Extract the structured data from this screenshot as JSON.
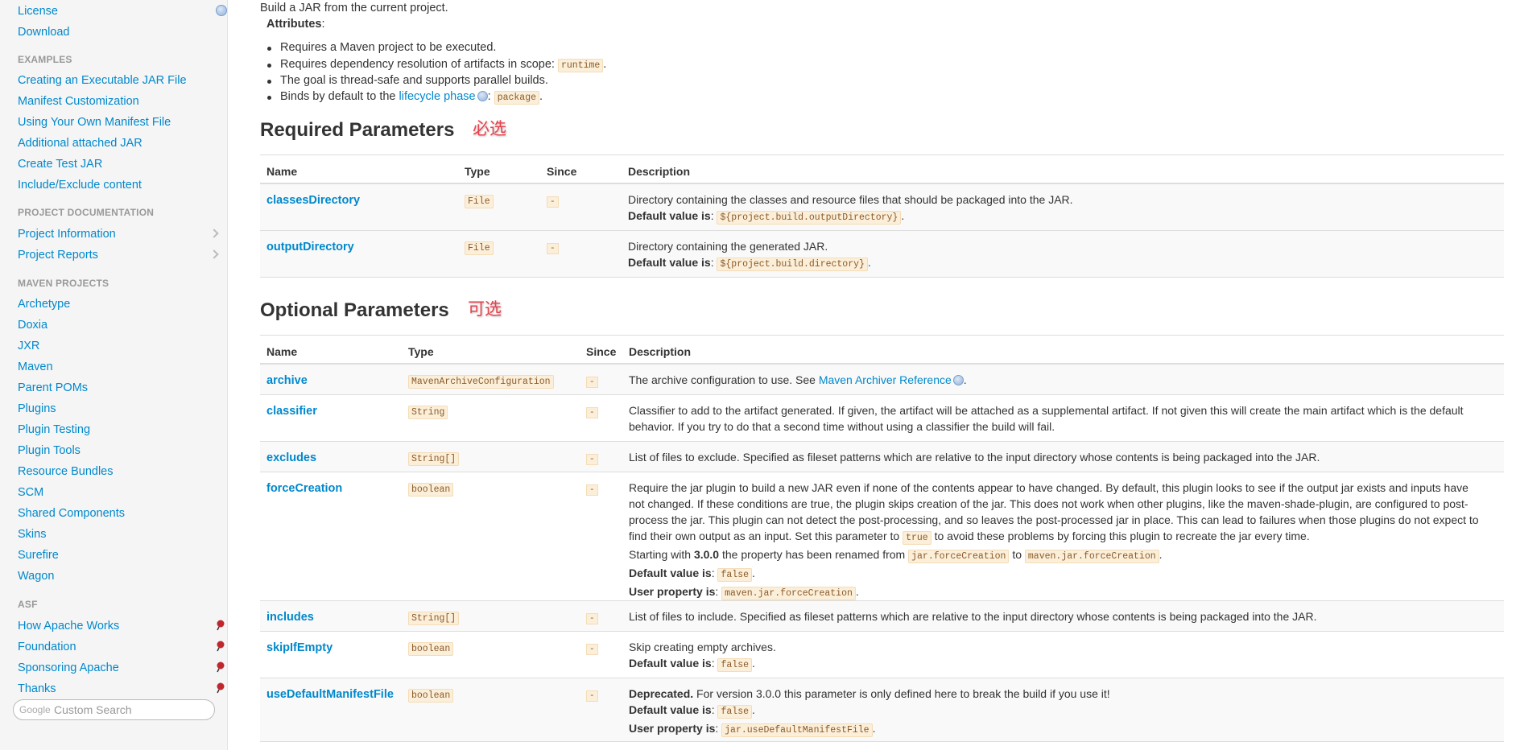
{
  "sidebar": {
    "top_items": [
      "License",
      "Download"
    ],
    "examples_header": "EXAMPLES",
    "examples": [
      "Creating an Executable JAR File",
      "Manifest Customization",
      "Using Your Own Manifest File",
      "Additional attached JAR",
      "Create Test JAR",
      "Include/Exclude content"
    ],
    "project_doc_header": "PROJECT DOCUMENTATION",
    "project_doc": [
      "Project Information",
      "Project Reports"
    ],
    "maven_header": "MAVEN PROJECTS",
    "maven": [
      "Archetype",
      "Doxia",
      "JXR",
      "Maven",
      "Parent POMs",
      "Plugins",
      "Plugin Testing",
      "Plugin Tools",
      "Resource Bundles",
      "SCM",
      "Shared Components",
      "Skins",
      "Surefire",
      "Wagon"
    ],
    "asf_header": "ASF",
    "asf": [
      "How Apache Works",
      "Foundation",
      "Sponsoring Apache",
      "Thanks"
    ],
    "search_logo": "Google",
    "search_placeholder": "Custom Search"
  },
  "intro": {
    "line": "Build a JAR from the current project.",
    "attributes_label": "Attributes",
    "colon": ":",
    "b1": "Requires a Maven project to be executed.",
    "b2_text": "Requires dependency resolution of artifacts in scope: ",
    "b2_code": "runtime",
    "b2_end": ".",
    "b3": "The goal is thread-safe and supports parallel builds.",
    "b4_text": "Binds by default to the ",
    "b4_link": "lifecycle phase",
    "b4_colon": ": ",
    "b4_code": "package",
    "b4_end": "."
  },
  "required": {
    "title": "Required Parameters",
    "annotation": "必选",
    "headers": [
      "Name",
      "Type",
      "Since",
      "Description"
    ],
    "rows": [
      {
        "name": "classesDirectory",
        "type": "File",
        "since": "-",
        "desc": "Directory containing the classes and resource files that should be packaged into the JAR.",
        "default_label": "Default value is",
        "default": "${project.build.outputDirectory}"
      },
      {
        "name": "outputDirectory",
        "type": "File",
        "since": "-",
        "desc": "Directory containing the generated JAR.",
        "default_label": "Default value is",
        "default": "${project.build.directory}"
      }
    ]
  },
  "optional": {
    "title": "Optional Parameters",
    "annotation": "可选",
    "headers": [
      "Name",
      "Type",
      "Since",
      "Description"
    ],
    "rows": [
      {
        "name": "archive",
        "type": "MavenArchiveConfiguration",
        "since": "-",
        "desc": "The archive configuration to use. See ",
        "link": "Maven Archiver Reference"
      },
      {
        "name": "classifier",
        "type": "String",
        "since": "-",
        "desc1": "Classifier to add to the artifact generated. If given, the artifact will be attached as a supplemental artifact. If not given this will create the main artifact which is the default",
        "desc2": "behavior. If you try to do that a second time without using a classifier the build will fail."
      },
      {
        "name": "excludes",
        "type": "String[]",
        "since": "-",
        "desc": "List of files to exclude. Specified as fileset patterns which are relative to the input directory whose contents is being packaged into the JAR."
      },
      {
        "name": "forceCreation",
        "type": "boolean",
        "since": "-",
        "l1": "Require the jar plugin to build a new JAR even if none of the contents appear to have changed. By default, this plugin looks to see if the output jar exists and inputs have",
        "l2": "not changed. If these conditions are true, the plugin skips creation of the jar. This does not work when other plugins, like the maven-shade-plugin, are configured to post-",
        "l3": "process the jar. This plugin can not detect the post-processing, and so leaves the post-processed jar in place. This can lead to failures when those plugins do not expect to",
        "l4a": "find their own output as an input. Set this parameter to ",
        "l4code": "true",
        "l4b": " to avoid these problems by forcing this plugin to recreate the jar every time.",
        "l5a": "Starting with ",
        "l5b": "3.0.0",
        "l5c": " the property has been renamed from ",
        "l5code1": "jar.forceCreation",
        "l5d": " to ",
        "l5code2": "maven.jar.forceCreation",
        "default_label": "Default value is",
        "default": "false",
        "user_label": "User property is",
        "user": "maven.jar.forceCreation"
      },
      {
        "name": "includes",
        "type": "String[]",
        "since": "-",
        "desc": "List of files to include. Specified as fileset patterns which are relative to the input directory whose contents is being packaged into the JAR."
      },
      {
        "name": "skipIfEmpty",
        "type": "boolean",
        "since": "-",
        "desc": "Skip creating empty archives.",
        "default_label": "Default value is",
        "default": "false"
      },
      {
        "name": "useDefaultManifestFile",
        "type": "boolean",
        "since": "-",
        "deprecated": "Deprecated.",
        "desc": " For version 3.0.0 this parameter is only defined here to break the build if you use it!",
        "default_label": "Default value is",
        "default": "false",
        "user_label": "User property is",
        "user": "jar.useDefaultManifestFile"
      }
    ]
  },
  "punct": {
    "colon": ": ",
    "period": "."
  },
  "colors": {
    "link": "#0088cc",
    "annotation": "#e8424c",
    "code_bg": "#fcefd9"
  }
}
